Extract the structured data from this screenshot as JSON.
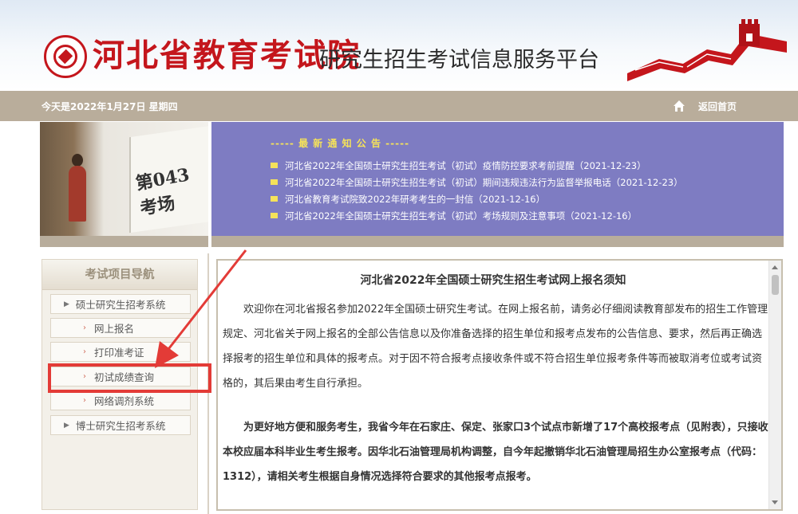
{
  "header": {
    "brand": "河北省教育考试院",
    "platform": "研究生招生考试信息服务平台"
  },
  "topbar": {
    "date": "今天是2022年1月27日 星期四",
    "home_link": "返回首页"
  },
  "photo": {
    "placard_text": "第043考场"
  },
  "notices": {
    "title": "----- 最 新 通 知 公 告 -----",
    "items": [
      "河北省2022年全国硕士研究生招生考试（初试）疫情防控要求考前提醒（2021-12-23）",
      "河北省2022年全国硕士研究生招生考试（初试）期间违规违法行为监督举报电话（2021-12-23）",
      "河北省教育考试院致2022年研考考生的一封信（2021-12-16）",
      "河北省2022年全国硕士研究生招生考试（初试）考场规则及注意事项（2021-12-16）"
    ]
  },
  "sidebar": {
    "title": "考试项目导航",
    "items": [
      {
        "label": "硕士研究生招考系统"
      },
      {
        "label": "网上报名"
      },
      {
        "label": "打印准考证"
      },
      {
        "label": "初试成绩查询"
      },
      {
        "label": "网络调剂系统"
      },
      {
        "label": "博士研究生招考系统"
      }
    ]
  },
  "content": {
    "title": "河北省2022年全国硕士研究生招生考试网上报名须知",
    "para1": "欢迎你在河北省报名参加2022年全国硕士研究生考试。在网上报名前，请务必仔细阅读教育部发布的招生工作管理规定、河北省关于网上报名的全部公告信息以及你准备选择的招生单位和报考点发布的公告信息、要求，然后再正确选择报考的招生单位和具体的报考点。对于因不符合报考点接收条件或不符合招生单位报考条件等而被取消考位或考试资格的，其后果由考生自行承担。",
    "para2": "为更好地方便和服务考生，我省今年在石家庄、保定、张家口3个试点市新增了17个高校报考点（见附表），只接收本校应届本科毕业生考生报考。因华北石油管理局机构调整，自今年起撤销华北石油管理局招生办公室报考点（代码：1312），请相关考生根据自身情况选择符合要求的其他报考点报考。"
  },
  "colors": {
    "brand_red": "#c4161c",
    "topbar": "#b9ad9b",
    "notice_bg": "#7e7cc2",
    "notice_accent": "#f5e25a",
    "highlight": "#e33b37"
  }
}
